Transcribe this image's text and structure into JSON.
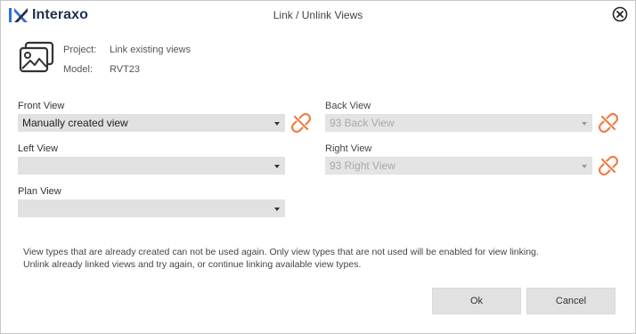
{
  "app": {
    "brand": "Interaxo",
    "title": "Link / Unlink Views"
  },
  "info": {
    "project_label": "Project:",
    "project_value": "Link existing views",
    "model_label": "Model:",
    "model_value": "RVT23"
  },
  "fields": {
    "front": {
      "label": "Front View",
      "value": "Manually created view",
      "enabled": true
    },
    "back": {
      "label": "Back View",
      "value": "93 Back View",
      "enabled": false
    },
    "left": {
      "label": "Left View",
      "value": "",
      "enabled": true
    },
    "right": {
      "label": "Right View",
      "value": "93 Right View",
      "enabled": false
    },
    "plan": {
      "label": "Plan View",
      "value": "",
      "enabled": true
    }
  },
  "note": {
    "line1": "View types that are already created can not be used again. Only view types that are not used  will be enabled for view linking.",
    "line2": "Unlink already linked views and try again, or continue linking available view types."
  },
  "buttons": {
    "ok": "Ok",
    "cancel": "Cancel"
  },
  "icons": {
    "logo": "interaxo-logo-icon",
    "close": "close-icon",
    "image": "image-gallery-icon",
    "unlink": "unlink-icon"
  },
  "colors": {
    "brand": "#23314f",
    "unlink_accent": "#f07c45",
    "dropdown_bg": "#e1e1e1",
    "disabled_text": "#a9a9a9"
  }
}
